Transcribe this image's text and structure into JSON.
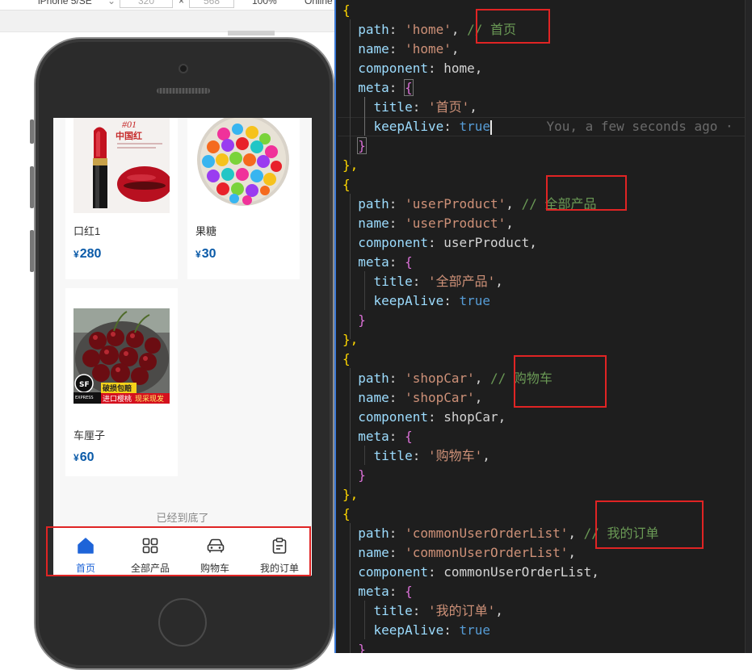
{
  "devtools": {
    "device": "iPhone 5/SE",
    "width": "320",
    "times": "×",
    "height": "568",
    "zoom": "100%",
    "throttle": "Online"
  },
  "products": [
    {
      "name": "口红1",
      "currency": "¥",
      "price": "280"
    },
    {
      "name": "果糖",
      "currency": "¥",
      "price": "30"
    },
    {
      "name": "车厘子",
      "currency": "¥",
      "price": "60"
    }
  ],
  "product_art": {
    "lipstick_badge_num": "#01",
    "lipstick_badge_text": "中国红",
    "cherry_badge_logo": "SF",
    "cherry_badge_express": "EXPRESS",
    "cherry_banner_1": "破损包赔",
    "cherry_banner_2": "进口樱桃",
    "cherry_banner_3": "现采现发"
  },
  "list_end_text": "已经到底了",
  "tabbar": [
    {
      "label": "首页",
      "icon": "home-icon",
      "active": true
    },
    {
      "label": "全部产品",
      "icon": "grid-icon",
      "active": false
    },
    {
      "label": "购物车",
      "icon": "car-icon",
      "active": false
    },
    {
      "label": "我的订单",
      "icon": "order-icon",
      "active": false
    }
  ],
  "colors": {
    "active_tab": "#1e64d8",
    "price": "#0a5aa8",
    "annotation_box": "#e02424",
    "editor_bg": "#1e1e1e"
  },
  "code": {
    "brace_open": "{",
    "brace_close": "}",
    "brace_close_comma": "},",
    "key_path": "path",
    "key_name": "name",
    "key_component": "component",
    "key_meta": "meta",
    "key_title": "title",
    "key_keepalive": "keepAlive",
    "val_true": "true",
    "blame": "You, a few seconds ago ·",
    "routes": [
      {
        "path": "'home'",
        "comment": "// 首页",
        "name": "'home'",
        "component": "home",
        "title": "'首页'"
      },
      {
        "path": "'userProduct'",
        "comment": "// 全部产品",
        "name": "'userProduct'",
        "component": "userProduct",
        "title": "'全部产品'"
      },
      {
        "path": "'shopCar'",
        "comment": "// 购物车",
        "name": "'shopCar'",
        "component": "shopCar",
        "title": "'购物车'"
      },
      {
        "path": "'commonUserOrderList'",
        "comment": "// 我的订单",
        "name": "'commonUserOrderList'",
        "component": "commonUserOrderList",
        "title": "'我的订单'"
      }
    ]
  }
}
